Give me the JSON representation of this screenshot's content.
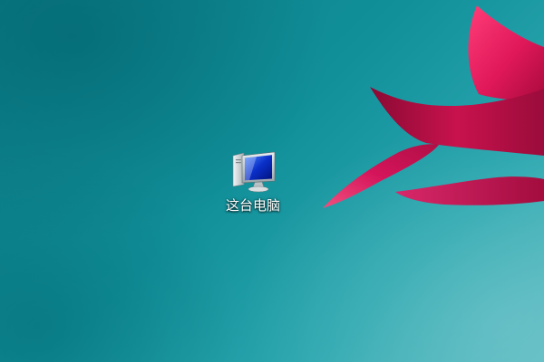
{
  "desktop": {
    "background_color": "#11909a",
    "accent_flower_color": "#e0185a",
    "icons": [
      {
        "label": "这台电脑",
        "icon": "this-pc-monitor-icon"
      }
    ]
  }
}
